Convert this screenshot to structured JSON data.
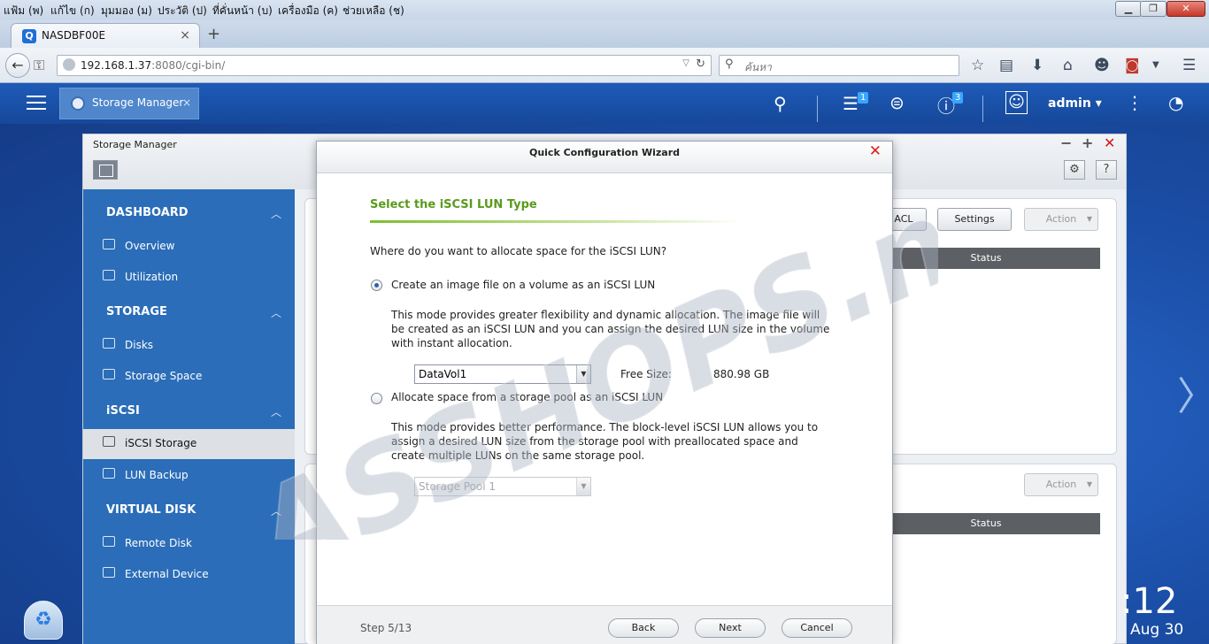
{
  "browser": {
    "menu": [
      "แฟ้ม (พ)",
      "แก้ไข (ก)",
      "มุมมอง (ม)",
      "ประวัติ (ป)",
      "ที่คั่นหน้า (บ)",
      "เครื่องมือ (ค)",
      "ช่วยเหลือ (ช)"
    ],
    "tab_title": "NASDBF00E",
    "tab_close": "×",
    "new_tab": "+",
    "url_host": "192.168.1.37",
    "url_rest": ":8080/cgi-bin/",
    "search_placeholder": "ค้นหา"
  },
  "qts": {
    "app_tab_label": "Storage Manager",
    "app_tab_close": "×",
    "tasks_badge": "1",
    "info_badge": "3",
    "user": "admin ▾"
  },
  "storage_manager": {
    "title": "Storage Manager",
    "win_min": "−",
    "win_max": "+",
    "win_close": "✕",
    "gear": "⚙",
    "help": "?",
    "sidebar": {
      "dashboard": "DASHBOARD",
      "overview": "Overview",
      "utilization": "Utilization",
      "storage": "STORAGE",
      "disks": "Disks",
      "storage_space": "Storage Space",
      "iscsi": "iSCSI",
      "iscsi_storage": "iSCSI Storage",
      "lun_backup": "LUN Backup",
      "virtual_disk": "VIRTUAL DISK",
      "remote_disk": "Remote Disk",
      "external_device": "External Device"
    },
    "panel_top": {
      "acl": "ACL",
      "settings": "Settings",
      "action": "Action",
      "status": "Status"
    },
    "panel_bottom": {
      "action": "Action",
      "status": "Status"
    }
  },
  "desktop": {
    "clock": ":12",
    "date": "Aug 30"
  },
  "dialog": {
    "title": "Quick Configuration Wizard",
    "close": "✕",
    "heading": "Select the iSCSI LUN Type",
    "question": "Where do you want to allocate space for the iSCSI LUN?",
    "option1_label": "Create an image file on a volume as an iSCSI LUN",
    "option1_desc": "This mode provides greater flexibility and dynamic allocation. The image file will be created as an iSCSI LUN and you can assign the desired LUN size in the volume with instant allocation.",
    "volume_select": "DataVol1",
    "free_size_label": "Free Size:",
    "free_size_value": "880.98 GB",
    "option2_label": "Allocate space from a storage pool as an iSCSI LUN",
    "option2_desc": "This mode provides better performance. The block-level iSCSI LUN allows you to assign a desired LUN size from the storage pool with preallocated space and create multiple LUNs on the same storage pool.",
    "pool_select": "Storage Pool 1",
    "step": "Step 5/13",
    "back": "Back",
    "next": "Next",
    "cancel": "Cancel"
  },
  "watermark": "NASSHOPS.net"
}
